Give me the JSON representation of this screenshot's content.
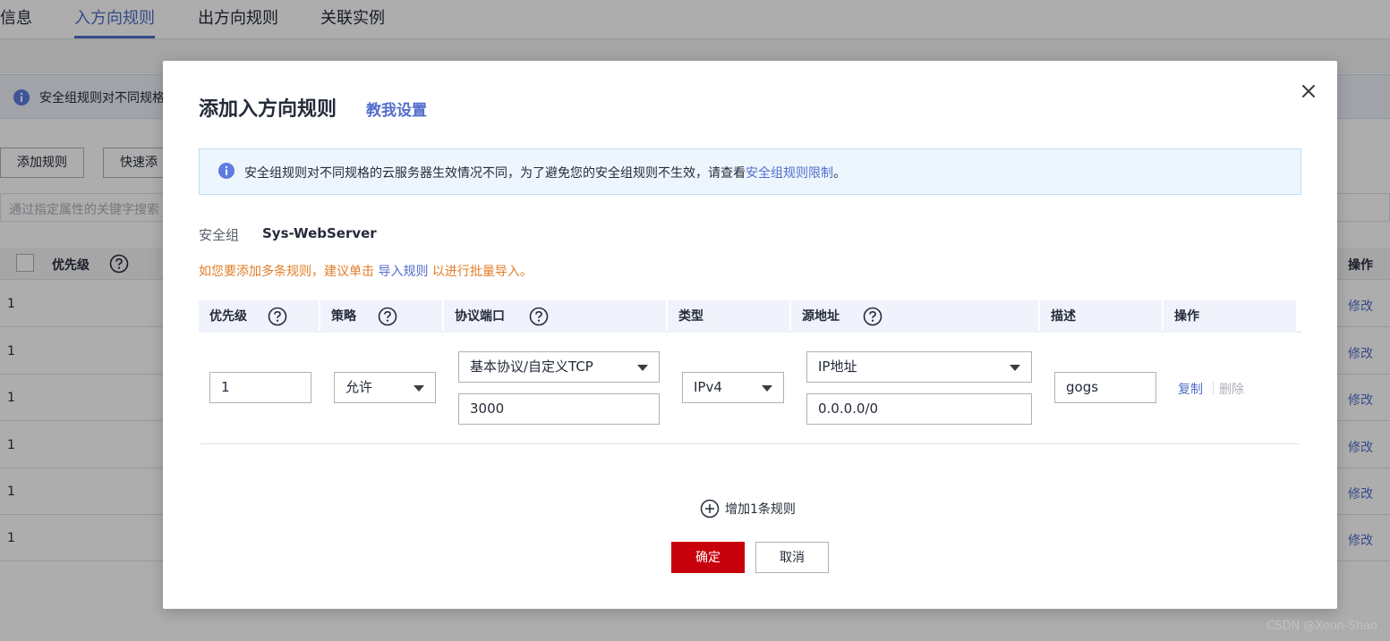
{
  "tabs": [
    {
      "label": "信息"
    },
    {
      "label": "入方向规则"
    },
    {
      "label": "出方向规则"
    },
    {
      "label": "关联实例"
    }
  ],
  "background": {
    "alert_text": "安全组规则对不同规格",
    "add_rule_btn": "添加规则",
    "quick_add_btn": "快速添",
    "search_placeholder": "通过指定属性的关键字搜索",
    "col_priority": "优先级",
    "col_action": "操作",
    "rows": [
      {
        "priority": "1",
        "edit": "修改"
      },
      {
        "priority": "1",
        "edit": "修改"
      },
      {
        "priority": "1",
        "edit": "修改"
      },
      {
        "priority": "1",
        "edit": "修改"
      },
      {
        "priority": "1",
        "edit": "修改"
      },
      {
        "priority": "1",
        "edit": "修改"
      }
    ]
  },
  "dialog": {
    "title": "添加入方向规则",
    "help_link": "教我设置",
    "alert": {
      "text": "安全组规则对不同规格的云服务器生效情况不同，为了避免您的安全组规则不生效，请查看",
      "link": "安全组规则限制",
      "suffix": "。"
    },
    "security_group_label": "安全组",
    "security_group_value": "Sys-WebServer",
    "tip": {
      "prefix": "如您要添加多条规则，建议单击 ",
      "link": "导入规则",
      "suffix": " 以进行批量导入。"
    },
    "columns": {
      "priority": "优先级",
      "policy": "策略",
      "protocol_port": "协议端口",
      "type": "类型",
      "source": "源地址",
      "description": "描述",
      "action": "操作"
    },
    "rule": {
      "priority": "1",
      "policy": "允许",
      "protocol": "基本协议/自定义TCP",
      "port": "3000",
      "type": "IPv4",
      "source_type": "IP地址",
      "source_addr": "0.0.0.0/0",
      "description": "gogs",
      "copy": "复制",
      "delete": "删除"
    },
    "add_rule": "增加1条规则",
    "ok": "确定",
    "cancel": "取消"
  },
  "watermark": "CSDN @Xeon-Shao",
  "colors": {
    "accent": "#526ecc",
    "primary_button": "#c7000b",
    "tip": "#e37d29",
    "info_icon": "#5e7ce0"
  }
}
